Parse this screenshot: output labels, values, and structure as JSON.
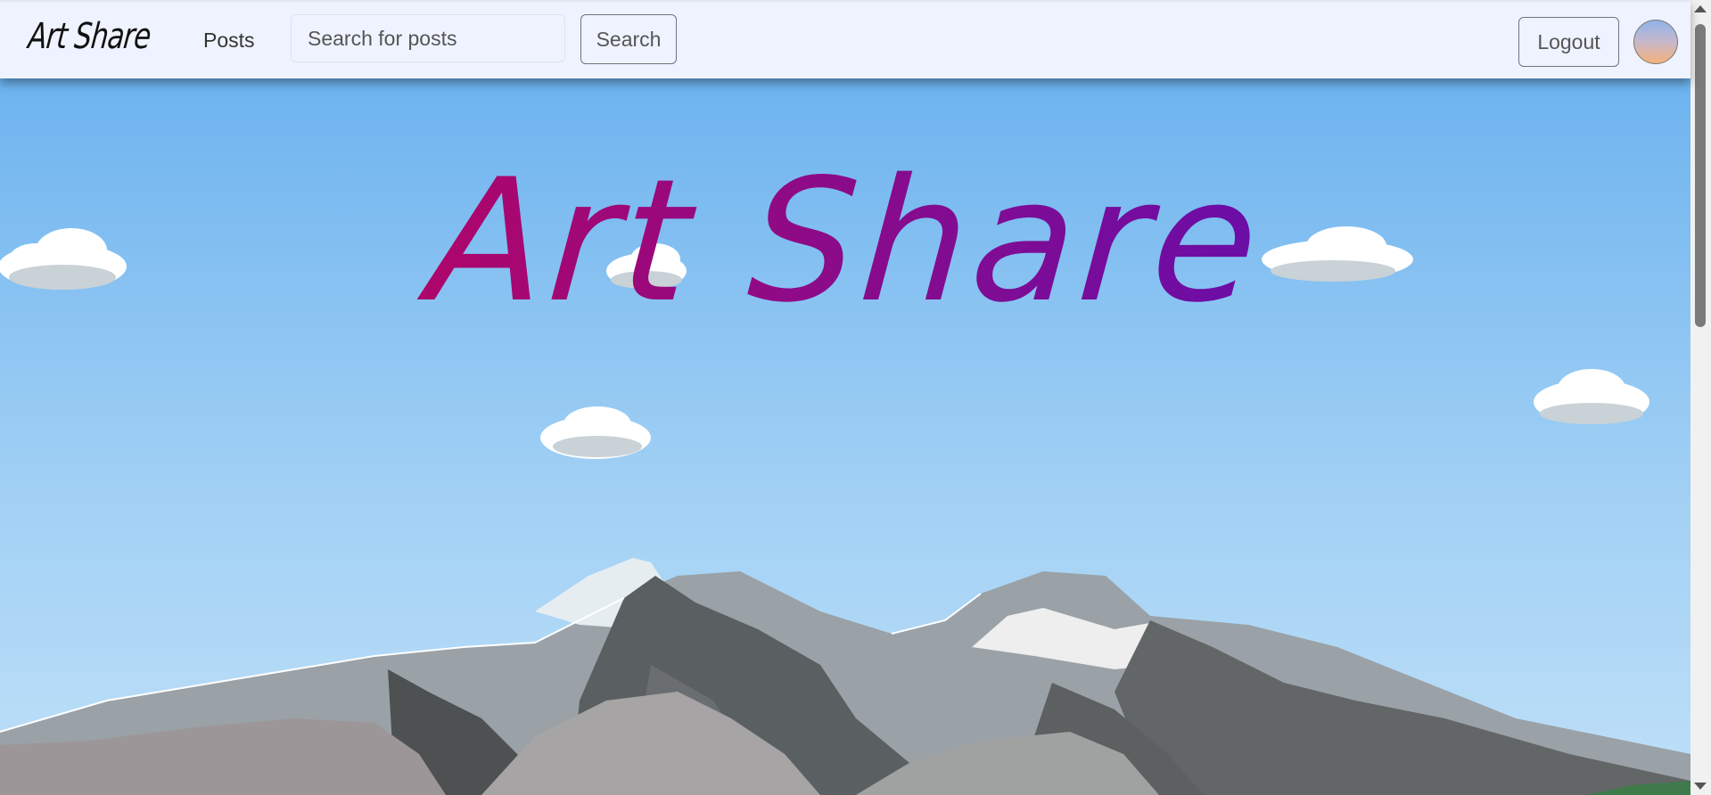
{
  "navbar": {
    "brand": "Art Share",
    "nav_links": [
      {
        "label": "Posts"
      }
    ],
    "search": {
      "placeholder": "Search for posts",
      "value": ""
    },
    "search_button": "Search",
    "logout_button": "Logout",
    "avatar_icon": "user-avatar-icon"
  },
  "hero": {
    "title": "Art Share",
    "title_gradient": [
      "#d2004a",
      "#8a0b8a",
      "#4b0fc4"
    ]
  },
  "colors": {
    "navbar_bg": "#eef3ff",
    "sky_top": "#6db3ef",
    "sky_bottom": "#bfe0f8"
  }
}
